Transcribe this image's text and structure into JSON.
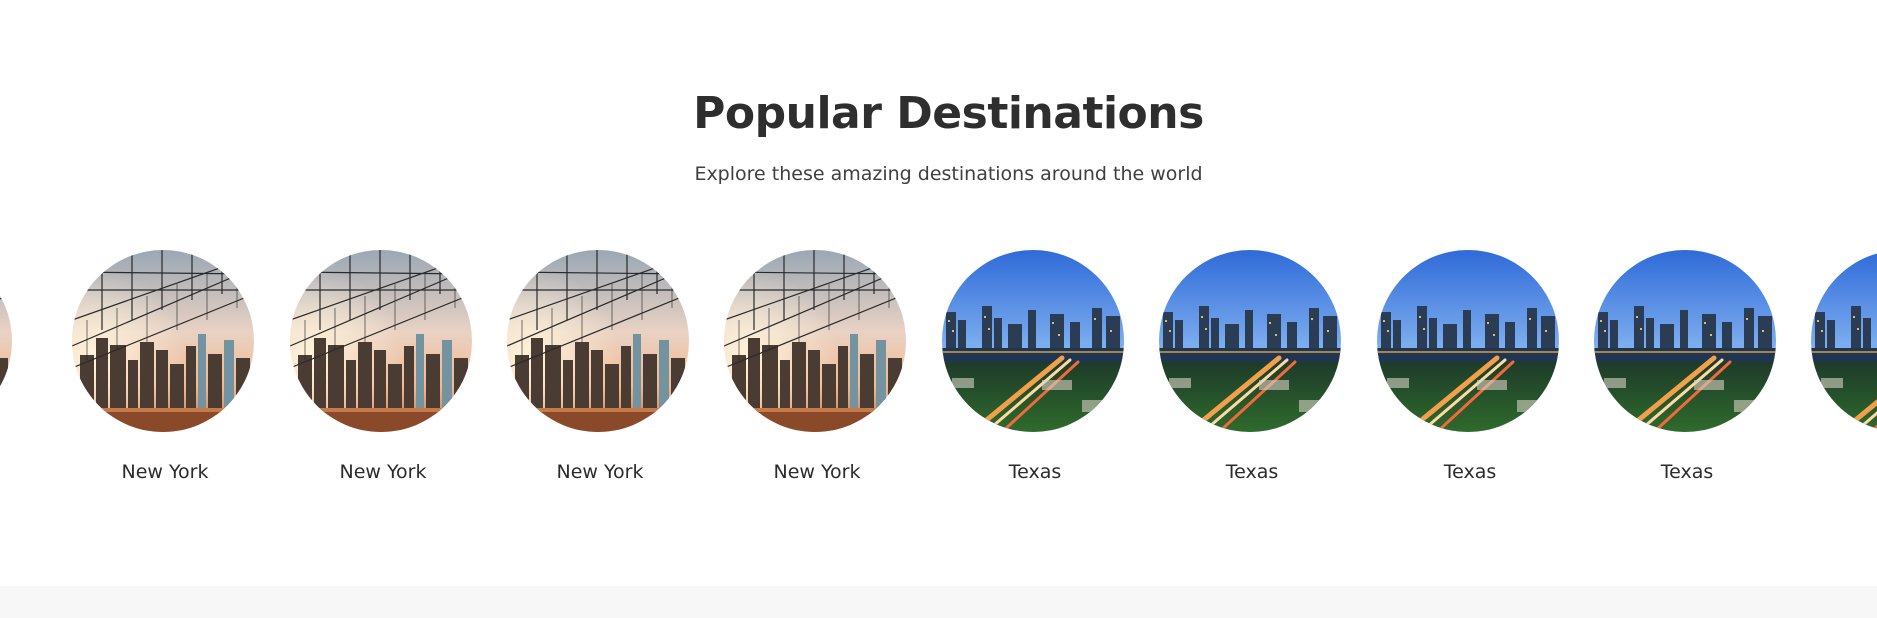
{
  "section": {
    "title": "Popular Destinations",
    "subtitle": "Explore these amazing destinations around the world"
  },
  "destinations": [
    {
      "name": "",
      "scene": "new-york"
    },
    {
      "name": "New York",
      "scene": "new-york"
    },
    {
      "name": "New York",
      "scene": "new-york"
    },
    {
      "name": "New York",
      "scene": "new-york"
    },
    {
      "name": "New York",
      "scene": "new-york"
    },
    {
      "name": "Texas",
      "scene": "texas"
    },
    {
      "name": "Texas",
      "scene": "texas"
    },
    {
      "name": "Texas",
      "scene": "texas"
    },
    {
      "name": "Texas",
      "scene": "texas"
    },
    {
      "name": "",
      "scene": "texas"
    }
  ],
  "colors": {
    "title": "#2e2e2e",
    "subtitle": "#3f3f3f",
    "label": "#2b2b2b",
    "footer_background": "#f7f7f7"
  }
}
